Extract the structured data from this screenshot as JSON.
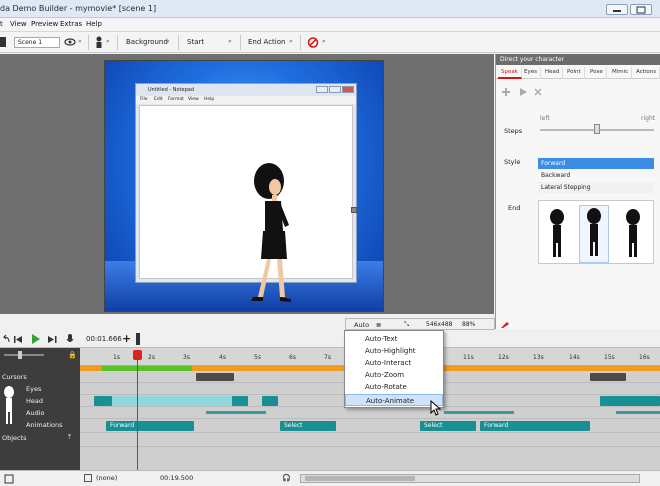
{
  "window": {
    "title": "da Demo Builder - mymovie* [scene 1]"
  },
  "menu": [
    "t",
    "View",
    "Preview",
    "Extras",
    "Help"
  ],
  "toolbar": {
    "scene_value": "Scene 1",
    "background_label": "Background",
    "start_label": "Start",
    "end_action_label": "End Action"
  },
  "notepad": {
    "title": "Untitled - Notepad",
    "menu": [
      "File",
      "Edit",
      "Format",
      "View",
      "Help"
    ]
  },
  "right_panel": {
    "header": "Direct your character",
    "tabs": [
      "Speak",
      "Eyes",
      "Head",
      "Point",
      "Pose",
      "Mimic",
      "Actions"
    ],
    "active_tab": "Speak",
    "steps_label": "Steps",
    "steps_left": "left",
    "steps_right": "right",
    "style_label": "Style",
    "style_options": [
      "Forward",
      "Backward",
      "Lateral Stepping"
    ],
    "style_selected": "Forward",
    "end_label": "End"
  },
  "stage_status": {
    "auto_label": "Auto",
    "resolution": "546x488",
    "zoom": "88%"
  },
  "timeline": {
    "time": "00:01.666",
    "tracks": [
      "Cursors",
      "Eyes",
      "Head",
      "Audio",
      "Animations",
      "Objects"
    ],
    "ruler_ticks": [
      "1s",
      "2s",
      "3s",
      "4s",
      "5s",
      "6s",
      "7s",
      "11s",
      "12s",
      "13s",
      "14s",
      "15s",
      "16s"
    ],
    "clips": {
      "forward1": "Forward",
      "select1": "Select",
      "select2": "Select",
      "forward2": "Forward"
    }
  },
  "dropdown": {
    "items": [
      "Auto-Text",
      "Auto-Highlight",
      "Auto-Interact",
      "Auto-Zoom",
      "Auto-Rotate",
      "Auto-Animate"
    ],
    "hovered": "Auto-Animate"
  },
  "bottombar": {
    "none_label": "(none)",
    "time": "00:19.500"
  },
  "colors": {
    "accent_red": "#d11111",
    "timeline_orange": "#f39a1e",
    "timeline_green": "#56c22a",
    "clip_teal": "#178f93",
    "stage_blue": "#1f6fe0"
  }
}
